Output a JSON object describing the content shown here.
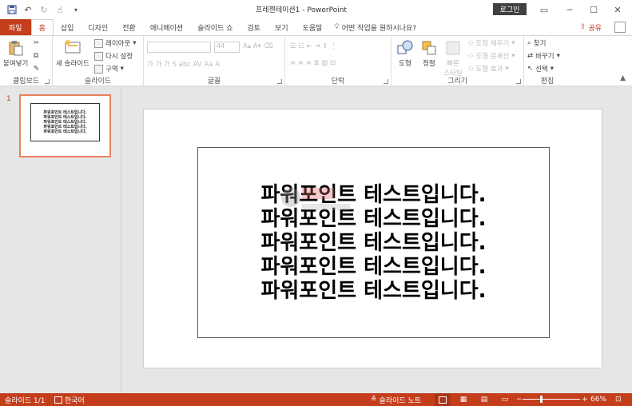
{
  "titlebar": {
    "title": "프레젠테이션1  -  PowerPoint",
    "login_label": "로그인",
    "qat_icons": [
      "save-icon",
      "undo-icon",
      "redo-icon",
      "touch-mode-icon",
      "customize-icon"
    ]
  },
  "tabs": [
    {
      "label": "파일",
      "kind": "file"
    },
    {
      "label": "홈",
      "kind": "active"
    },
    {
      "label": "삽입"
    },
    {
      "label": "디자인"
    },
    {
      "label": "전환"
    },
    {
      "label": "애니메이션"
    },
    {
      "label": "슬라이드 쇼"
    },
    {
      "label": "검토"
    },
    {
      "label": "보기"
    },
    {
      "label": "도움말"
    }
  ],
  "tell_me": "어떤 작업을 원하시나요?",
  "share_label": "공유",
  "ribbon": {
    "clipboard": {
      "label": "클립보드",
      "paste": "붙여넣기"
    },
    "slides": {
      "label": "슬라이드",
      "new_slide": "새 슬라이드",
      "layout": "레이아웃",
      "reset": "다시 설정",
      "section": "구역"
    },
    "font": {
      "label": "글꼴",
      "size": "44"
    },
    "paragraph": {
      "label": "단락"
    },
    "drawing": {
      "label": "그리기",
      "shapes": "도형",
      "arrange": "정렬",
      "quick_styles": "빠른 스타일",
      "fill": "도형 채우기",
      "outline": "도형 윤곽선",
      "effects": "도형 효과"
    },
    "editing": {
      "label": "편집",
      "find": "찾기",
      "replace": "바꾸기",
      "select": "선택"
    }
  },
  "thumbnail": {
    "number": "1",
    "lines": [
      "파워포인트 테스트입니다.",
      "파워포인트 테스트입니다.",
      "파워포인트 테스트입니다.",
      "파워포인트 테스트입니다.",
      "파워포인트 테스트입니다."
    ]
  },
  "slide": {
    "lines": [
      "파워포인트 테스트입니다.",
      "파워포인트 테스트입니다.",
      "파워포인트 테스트입니다.",
      "파워포인트 테스트입니다.",
      "파워포인트 테스트입니다."
    ]
  },
  "status": {
    "slide_count": "슬라이드 1/1",
    "language": "한국어",
    "notes": "슬라이드 노트",
    "zoom": "66%"
  },
  "colors": {
    "accent": "#c43e1c",
    "status_bar": "#c43e1c"
  }
}
